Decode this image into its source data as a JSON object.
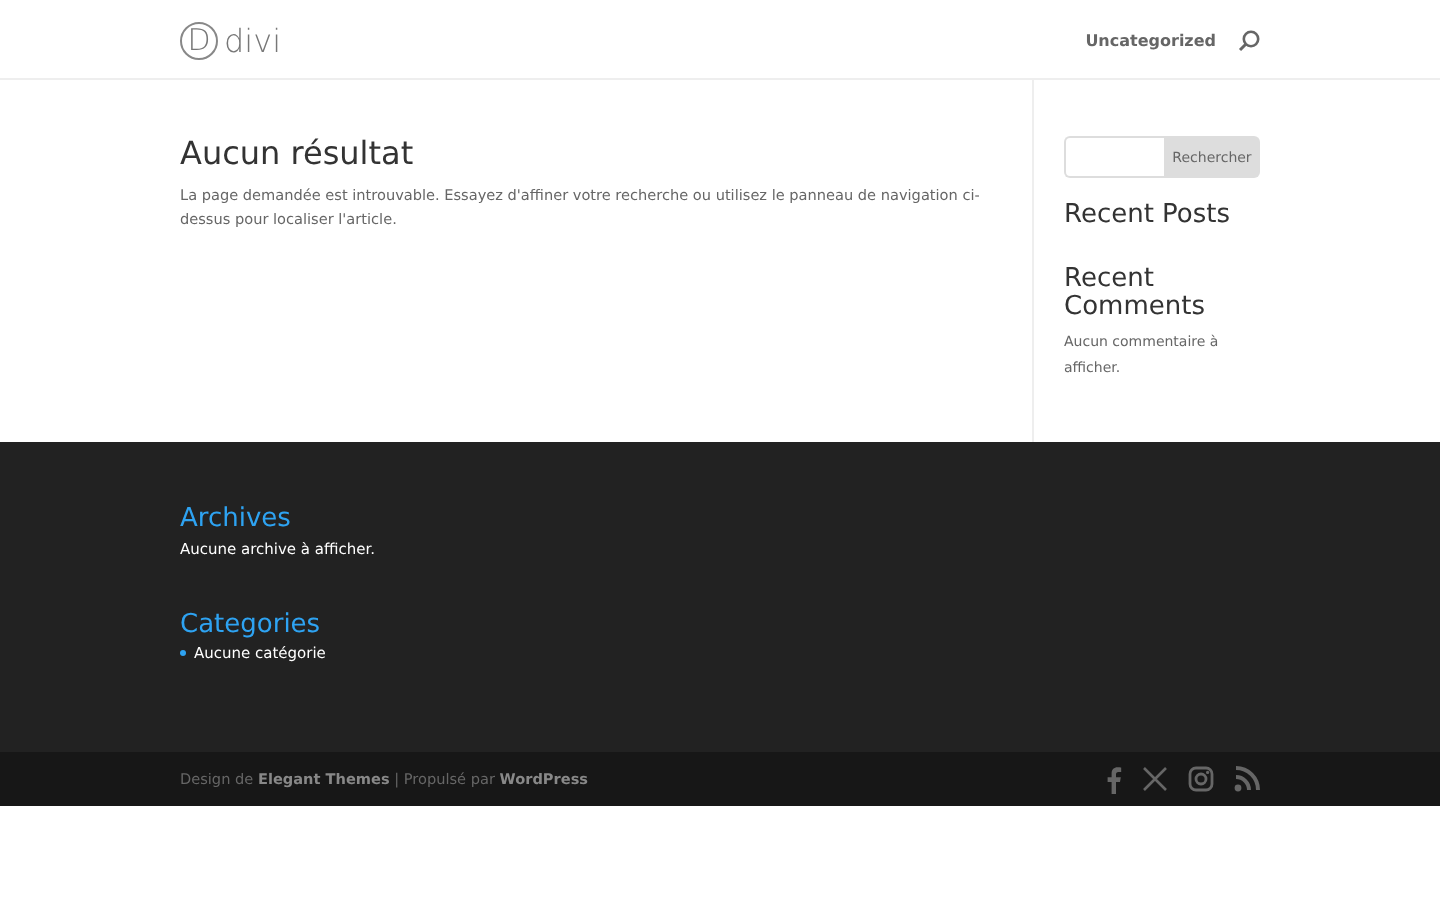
{
  "header": {
    "logo_letter": "D",
    "logo_text": "divi",
    "menu": [
      {
        "label": "Uncategorized"
      }
    ]
  },
  "main": {
    "title": "Aucun résultat",
    "text": "La page demandée est introuvable. Essayez d'affiner votre recherche ou utilisez le panneau de navigation ci-dessus pour localiser l'article."
  },
  "sidebar": {
    "search_button": "Rechercher",
    "recent_posts": "Recent Posts",
    "recent_comments": "Recent Comments",
    "comments_text": "Aucun commentaire à afficher."
  },
  "footer": {
    "archives_title": "Archives",
    "archives_text": "Aucune archive à afficher.",
    "categories_title": "Categories",
    "categories": [
      "Aucune catégorie"
    ]
  },
  "bottom_bar": {
    "credits": "Design de **Elegant Themes** | Propulsé par **WordPress**"
  }
}
